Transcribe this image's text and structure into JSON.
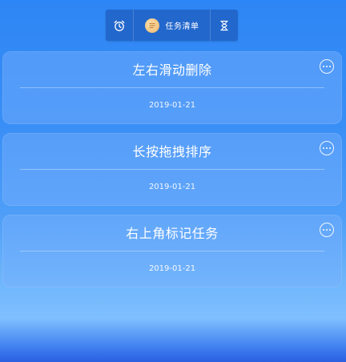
{
  "toolbar": {
    "alarm_icon": "alarm-clock-icon",
    "title": "任务清单",
    "list_icon": "list-avatar-icon",
    "timer_icon": "hourglass-icon"
  },
  "tasks": [
    {
      "title": "左右滑动删除",
      "date": "2019-01-21",
      "more_icon": "more-options-icon"
    },
    {
      "title": "长按拖拽排序",
      "date": "2019-01-21",
      "more_icon": "more-options-icon"
    },
    {
      "title": "右上角标记任务",
      "date": "2019-01-21",
      "more_icon": "more-options-icon"
    }
  ],
  "colors": {
    "background_top": "#2d86f5",
    "background_bottom": "#7fbfff",
    "toolbar": "#2062c4",
    "text": "#ffffff"
  }
}
